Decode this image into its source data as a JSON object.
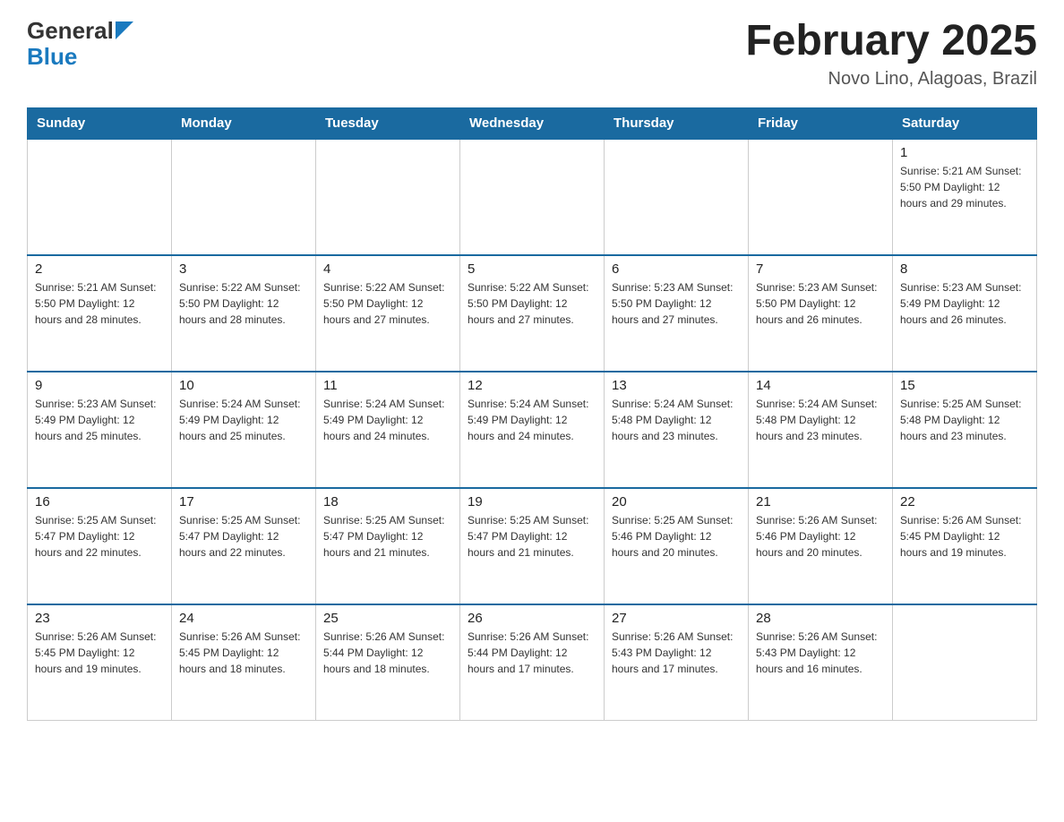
{
  "header": {
    "logo_general": "General",
    "logo_blue": "Blue",
    "month_title": "February 2025",
    "location": "Novo Lino, Alagoas, Brazil"
  },
  "days_of_week": [
    "Sunday",
    "Monday",
    "Tuesday",
    "Wednesday",
    "Thursday",
    "Friday",
    "Saturday"
  ],
  "weeks": [
    [
      {
        "day": "",
        "info": ""
      },
      {
        "day": "",
        "info": ""
      },
      {
        "day": "",
        "info": ""
      },
      {
        "day": "",
        "info": ""
      },
      {
        "day": "",
        "info": ""
      },
      {
        "day": "",
        "info": ""
      },
      {
        "day": "1",
        "info": "Sunrise: 5:21 AM\nSunset: 5:50 PM\nDaylight: 12 hours\nand 29 minutes."
      }
    ],
    [
      {
        "day": "2",
        "info": "Sunrise: 5:21 AM\nSunset: 5:50 PM\nDaylight: 12 hours\nand 28 minutes."
      },
      {
        "day": "3",
        "info": "Sunrise: 5:22 AM\nSunset: 5:50 PM\nDaylight: 12 hours\nand 28 minutes."
      },
      {
        "day": "4",
        "info": "Sunrise: 5:22 AM\nSunset: 5:50 PM\nDaylight: 12 hours\nand 27 minutes."
      },
      {
        "day": "5",
        "info": "Sunrise: 5:22 AM\nSunset: 5:50 PM\nDaylight: 12 hours\nand 27 minutes."
      },
      {
        "day": "6",
        "info": "Sunrise: 5:23 AM\nSunset: 5:50 PM\nDaylight: 12 hours\nand 27 minutes."
      },
      {
        "day": "7",
        "info": "Sunrise: 5:23 AM\nSunset: 5:50 PM\nDaylight: 12 hours\nand 26 minutes."
      },
      {
        "day": "8",
        "info": "Sunrise: 5:23 AM\nSunset: 5:49 PM\nDaylight: 12 hours\nand 26 minutes."
      }
    ],
    [
      {
        "day": "9",
        "info": "Sunrise: 5:23 AM\nSunset: 5:49 PM\nDaylight: 12 hours\nand 25 minutes."
      },
      {
        "day": "10",
        "info": "Sunrise: 5:24 AM\nSunset: 5:49 PM\nDaylight: 12 hours\nand 25 minutes."
      },
      {
        "day": "11",
        "info": "Sunrise: 5:24 AM\nSunset: 5:49 PM\nDaylight: 12 hours\nand 24 minutes."
      },
      {
        "day": "12",
        "info": "Sunrise: 5:24 AM\nSunset: 5:49 PM\nDaylight: 12 hours\nand 24 minutes."
      },
      {
        "day": "13",
        "info": "Sunrise: 5:24 AM\nSunset: 5:48 PM\nDaylight: 12 hours\nand 23 minutes."
      },
      {
        "day": "14",
        "info": "Sunrise: 5:24 AM\nSunset: 5:48 PM\nDaylight: 12 hours\nand 23 minutes."
      },
      {
        "day": "15",
        "info": "Sunrise: 5:25 AM\nSunset: 5:48 PM\nDaylight: 12 hours\nand 23 minutes."
      }
    ],
    [
      {
        "day": "16",
        "info": "Sunrise: 5:25 AM\nSunset: 5:47 PM\nDaylight: 12 hours\nand 22 minutes."
      },
      {
        "day": "17",
        "info": "Sunrise: 5:25 AM\nSunset: 5:47 PM\nDaylight: 12 hours\nand 22 minutes."
      },
      {
        "day": "18",
        "info": "Sunrise: 5:25 AM\nSunset: 5:47 PM\nDaylight: 12 hours\nand 21 minutes."
      },
      {
        "day": "19",
        "info": "Sunrise: 5:25 AM\nSunset: 5:47 PM\nDaylight: 12 hours\nand 21 minutes."
      },
      {
        "day": "20",
        "info": "Sunrise: 5:25 AM\nSunset: 5:46 PM\nDaylight: 12 hours\nand 20 minutes."
      },
      {
        "day": "21",
        "info": "Sunrise: 5:26 AM\nSunset: 5:46 PM\nDaylight: 12 hours\nand 20 minutes."
      },
      {
        "day": "22",
        "info": "Sunrise: 5:26 AM\nSunset: 5:45 PM\nDaylight: 12 hours\nand 19 minutes."
      }
    ],
    [
      {
        "day": "23",
        "info": "Sunrise: 5:26 AM\nSunset: 5:45 PM\nDaylight: 12 hours\nand 19 minutes."
      },
      {
        "day": "24",
        "info": "Sunrise: 5:26 AM\nSunset: 5:45 PM\nDaylight: 12 hours\nand 18 minutes."
      },
      {
        "day": "25",
        "info": "Sunrise: 5:26 AM\nSunset: 5:44 PM\nDaylight: 12 hours\nand 18 minutes."
      },
      {
        "day": "26",
        "info": "Sunrise: 5:26 AM\nSunset: 5:44 PM\nDaylight: 12 hours\nand 17 minutes."
      },
      {
        "day": "27",
        "info": "Sunrise: 5:26 AM\nSunset: 5:43 PM\nDaylight: 12 hours\nand 17 minutes."
      },
      {
        "day": "28",
        "info": "Sunrise: 5:26 AM\nSunset: 5:43 PM\nDaylight: 12 hours\nand 16 minutes."
      },
      {
        "day": "",
        "info": ""
      }
    ]
  ]
}
